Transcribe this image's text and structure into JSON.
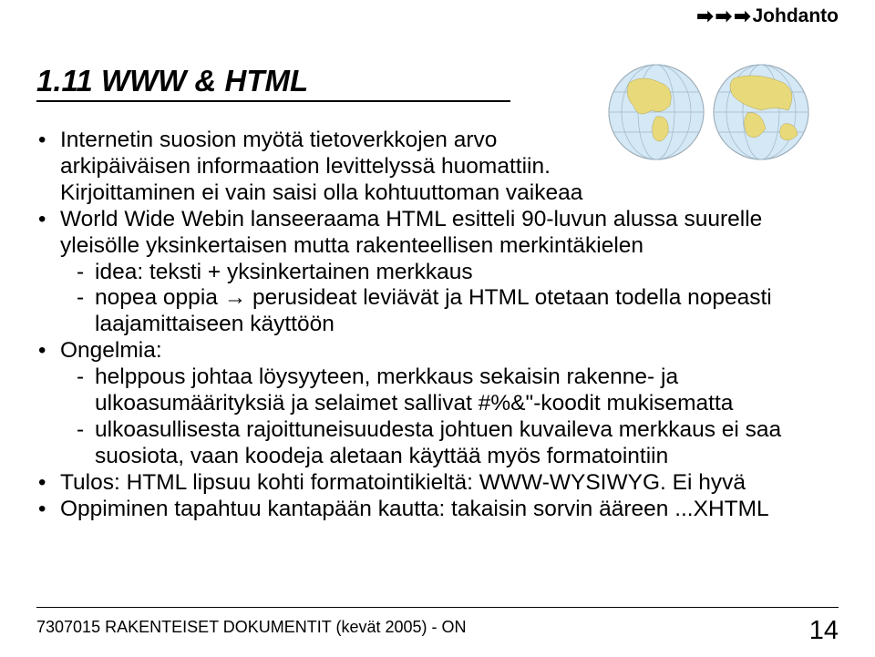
{
  "header": {
    "crumb": "Johdanto"
  },
  "title": "1.11 WWW & HTML",
  "bullets": {
    "b1": "Internetin suosion myötä tietoverkkojen arvo arkipäiväisen informaation levittelyssä huomattiin. Kirjoittaminen ei vain saisi olla kohtuuttoman vaikeaa",
    "b2": "World Wide Webin lanseeraama HTML esitteli 90-luvun alussa suurelle yleisölle yksinkertaisen mutta rakenteellisen merkintäkielen",
    "b2_s1": "idea: teksti + yksinkertainen merkkaus",
    "b2_s2_a": "nopea oppia ",
    "b2_s2_b": " perusideat leviävät ja HTML otetaan todella nopeasti laajamittaiseen käyttöön",
    "b3": "Ongelmia:",
    "b3_s1": "helppous johtaa löysyyteen, merkkaus sekaisin rakenne- ja ulkoasumäärityksiä ja selaimet sallivat #%&\"-koodit mukisematta",
    "b3_s2": "ulkoasullisesta rajoittuneisuudesta johtuen kuvaileva merkkaus ei saa suosiota, vaan koodeja aletaan käyttää myös formatointiin",
    "b4": "Tulos: HTML lipsuu kohti formatointikieltä: WWW-WYSIWYG. Ei hyvä",
    "b5": "Oppiminen tapahtuu kantapään kautta: takaisin sorvin ääreen ...XHTML"
  },
  "footer": {
    "left": "7307015 RAKENTEISET DOKUMENTIT (kevät 2005) - ON",
    "page": "14"
  }
}
